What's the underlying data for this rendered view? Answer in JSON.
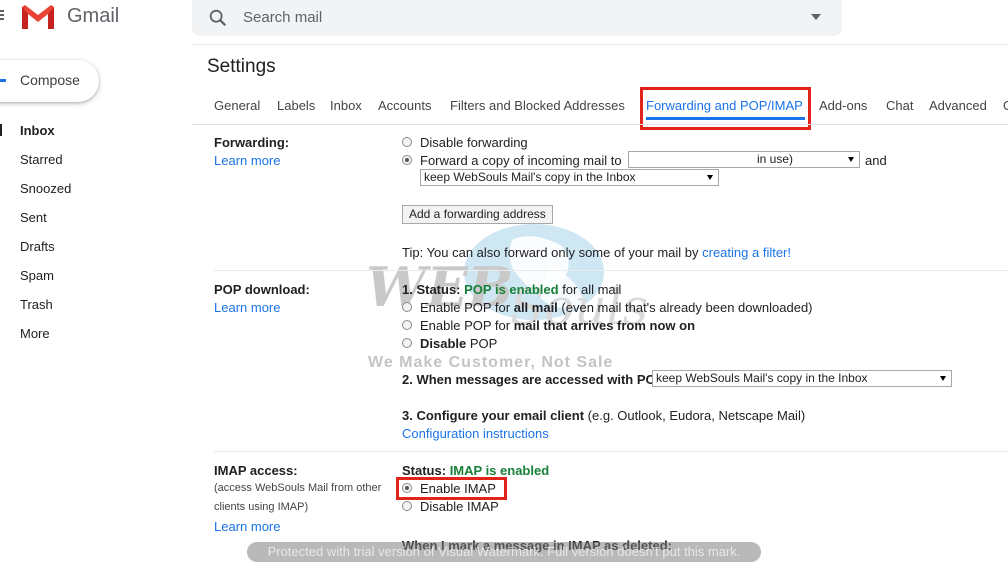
{
  "app": {
    "brand": "Gmail"
  },
  "search": {
    "placeholder": "Search mail"
  },
  "compose": {
    "label": "Compose"
  },
  "sidebar": {
    "items": [
      {
        "label": "Inbox",
        "active": true
      },
      {
        "label": "Starred"
      },
      {
        "label": "Snoozed"
      },
      {
        "label": "Sent"
      },
      {
        "label": "Drafts"
      },
      {
        "label": "Spam"
      },
      {
        "label": "Trash"
      },
      {
        "label": "More"
      }
    ]
  },
  "settings": {
    "title": "Settings",
    "tabs": [
      {
        "label": "General"
      },
      {
        "label": "Labels"
      },
      {
        "label": "Inbox"
      },
      {
        "label": "Accounts"
      },
      {
        "label": "Filters and Blocked Addresses"
      },
      {
        "label": "Forwarding and POP/IMAP",
        "active": true
      },
      {
        "label": "Add-ons"
      },
      {
        "label": "Chat"
      },
      {
        "label": "Advanced"
      },
      {
        "label": "O"
      }
    ]
  },
  "forwarding": {
    "label": "Forwarding:",
    "learn_more": "Learn more",
    "disable": "Disable forwarding",
    "forward_copy": "Forward a copy of incoming mail to",
    "address_value": "in use)",
    "and": "and",
    "keep_option": "keep WebSouls Mail's copy in the Inbox",
    "add_button": "Add a forwarding address",
    "tip_prefix": "Tip: You can also forward only some of your mail by",
    "tip_link": "creating a filter!"
  },
  "pop": {
    "label": "POP download:",
    "learn_more": "Learn more",
    "status_prefix": "1. Status:",
    "status_value": "POP is enabled",
    "status_suffix": "for all mail",
    "opt1_a": "Enable POP for",
    "opt1_b": "all mail",
    "opt1_c": "(even mail that's already been downloaded)",
    "opt2_a": "Enable POP for",
    "opt2_b": "mail that arrives from now on",
    "opt3_a": "Disable",
    "opt3_b": "POP",
    "q2": "2. When messages are accessed with POP",
    "q2_value": "keep WebSouls Mail's copy in the Inbox",
    "q3_bold": "3. Configure your email client",
    "q3_rest": "(e.g. Outlook, Eudora, Netscape Mail)",
    "config_link": "Configuration instructions"
  },
  "imap": {
    "label": "IMAP access:",
    "sub1": "(access WebSouls Mail from other",
    "sub2": "clients using IMAP)",
    "learn_more": "Learn more",
    "status_prefix": "Status:",
    "status_value": "IMAP is enabled",
    "enable": "Enable IMAP",
    "disable": "Disable IMAP",
    "deleted_heading": "When I mark a message in IMAP as deleted:"
  },
  "watermark": {
    "logo_text": "WEB Souls",
    "tagline": "We Make Customer, Not Sale",
    "trial_notice": "Protected with trial version of Visual Watermark. Full version doesn't put this mark."
  },
  "colors": {
    "accent": "#1a73e8",
    "enabled_green": "#188038",
    "highlight_red": "#e2231a"
  }
}
